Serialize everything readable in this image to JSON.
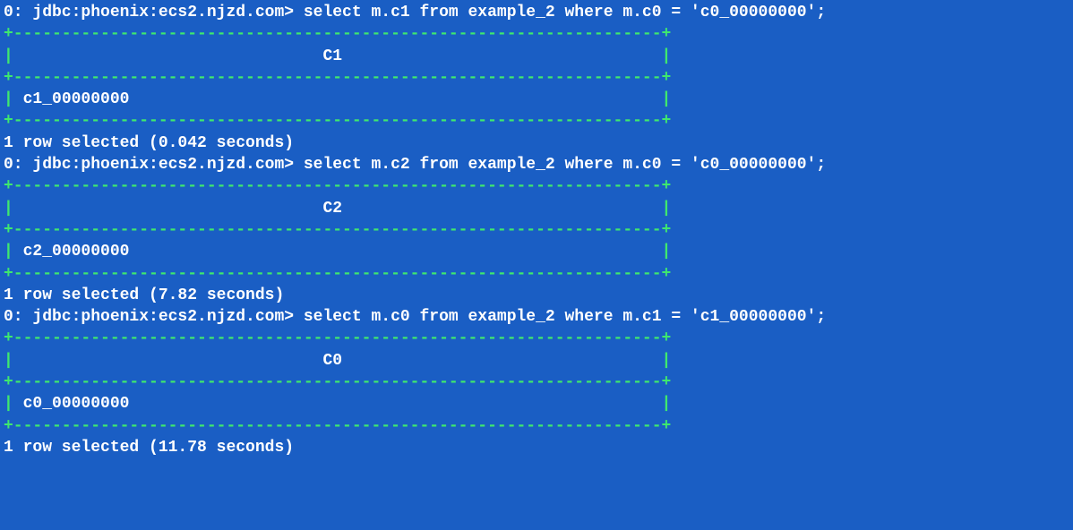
{
  "terminal": {
    "queries": [
      {
        "prompt": "0: jdbc:phoenix:ecs2.njzd.com> select m.c1 from example_2 where m.c0 = 'c0_00000000';",
        "border_top": "+-------------------------------------------------------------------+",
        "header_pipe_left": "|",
        "header_pad_left": "                                ",
        "header_text": "C1",
        "header_pad_right": "                                 ",
        "header_pipe_right": "|",
        "border_mid": "+-------------------------------------------------------------------+",
        "data_pipe_left": "|",
        "data_text": " c1_00000000                                                       ",
        "data_pipe_right": "|",
        "border_bottom": "+-------------------------------------------------------------------+",
        "status": "1 row selected (0.042 seconds)"
      },
      {
        "prompt": "0: jdbc:phoenix:ecs2.njzd.com> select m.c2 from example_2 where m.c0 = 'c0_00000000';",
        "border_top": "+-------------------------------------------------------------------+",
        "header_pipe_left": "|",
        "header_pad_left": "                                ",
        "header_text": "C2",
        "header_pad_right": "                                 ",
        "header_pipe_right": "|",
        "border_mid": "+-------------------------------------------------------------------+",
        "data_pipe_left": "|",
        "data_text": " c2_00000000                                                       ",
        "data_pipe_right": "|",
        "border_bottom": "+-------------------------------------------------------------------+",
        "status": "1 row selected (7.82 seconds)"
      },
      {
        "prompt": "0: jdbc:phoenix:ecs2.njzd.com> select m.c0 from example_2 where m.c1 = 'c1_00000000';",
        "border_top": "+-------------------------------------------------------------------+",
        "header_pipe_left": "|",
        "header_pad_left": "                                ",
        "header_text": "C0",
        "header_pad_right": "                                 ",
        "header_pipe_right": "|",
        "border_mid": "+-------------------------------------------------------------------+",
        "data_pipe_left": "|",
        "data_text": " c0_00000000                                                       ",
        "data_pipe_right": "|",
        "border_bottom": "+-------------------------------------------------------------------+",
        "status": "1 row selected (11.78 seconds)"
      }
    ]
  }
}
